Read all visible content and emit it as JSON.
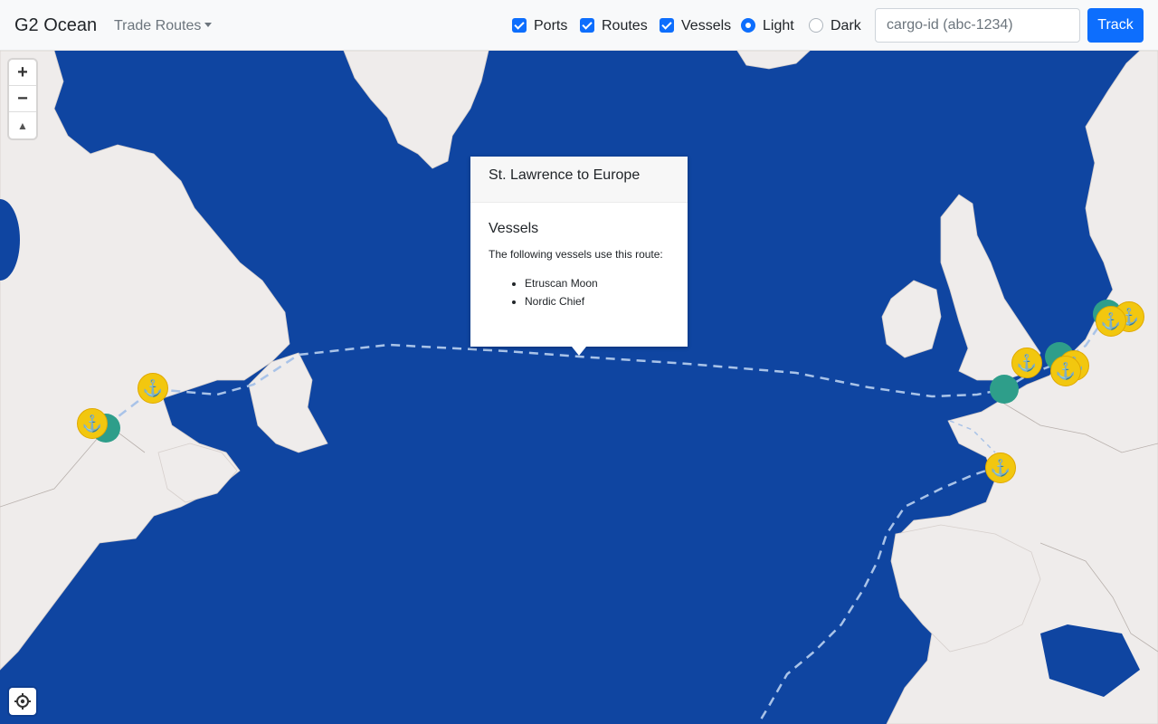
{
  "navbar": {
    "brand": "G2 Ocean",
    "dropdown_label": "Trade Routes",
    "toggles": [
      {
        "label": "Ports",
        "checked": true
      },
      {
        "label": "Routes",
        "checked": true
      },
      {
        "label": "Vessels",
        "checked": true
      }
    ],
    "themes": [
      {
        "label": "Light",
        "selected": true
      },
      {
        "label": "Dark",
        "selected": false
      }
    ],
    "search_placeholder": "cargo-id (abc-1234)",
    "track_label": "Track"
  },
  "map": {
    "controls": {
      "zoom_in": "+",
      "zoom_out": "−",
      "compass": "▲"
    },
    "colors": {
      "water": "#0f45a1",
      "land": "#efeceb",
      "port": "#f2c70f",
      "vessel": "#2e9e8a",
      "route": "#a9c3e8"
    }
  },
  "popup": {
    "title": "St. Lawrence to Europe",
    "section_title": "Vessels",
    "description": "The following vessels use this route:",
    "vessels": [
      "Etruscan Moon",
      "Nordic Chief"
    ]
  }
}
